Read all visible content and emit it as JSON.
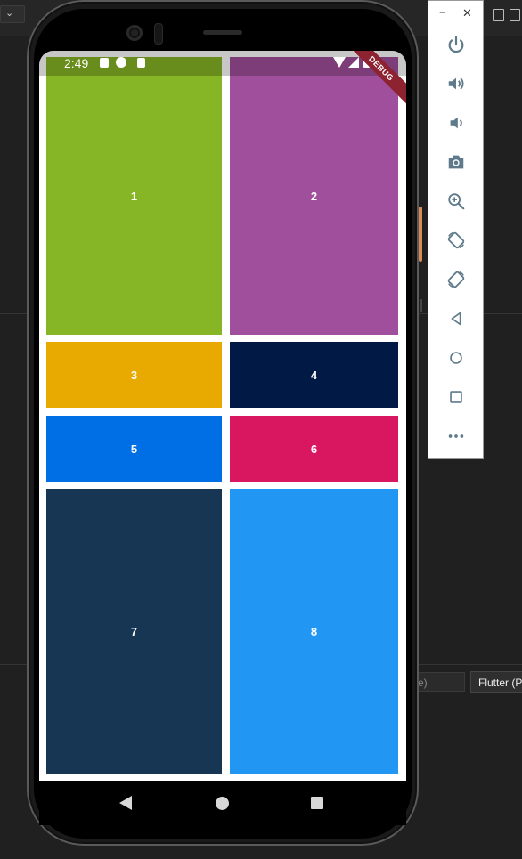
{
  "ide": {
    "field_text": "e)",
    "run_config_label": "Flutter (P"
  },
  "phone": {
    "status_time": "2:49",
    "debug_banner": "DEBUG",
    "tiles": [
      {
        "label": "1",
        "color": "#86b526"
      },
      {
        "label": "2",
        "color": "#a04f9c"
      },
      {
        "label": "3",
        "color": "#e8aa00"
      },
      {
        "label": "4",
        "color": "#001a45"
      },
      {
        "label": "5",
        "color": "#006fe6"
      },
      {
        "label": "6",
        "color": "#d81760"
      },
      {
        "label": "7",
        "color": "#173654"
      },
      {
        "label": "8",
        "color": "#2196f3"
      }
    ]
  },
  "emulator_toolbar": {
    "minimize": "−",
    "close": "✕",
    "buttons": [
      "power-icon",
      "volume-up-icon",
      "volume-down-icon",
      "camera-icon",
      "zoom-icon",
      "rotate-left-icon",
      "rotate-right-icon",
      "back-icon",
      "home-icon",
      "overview-icon",
      "more-icon"
    ]
  },
  "colors": {
    "accent": "#5f7a8a",
    "ide_background": "#202020"
  }
}
